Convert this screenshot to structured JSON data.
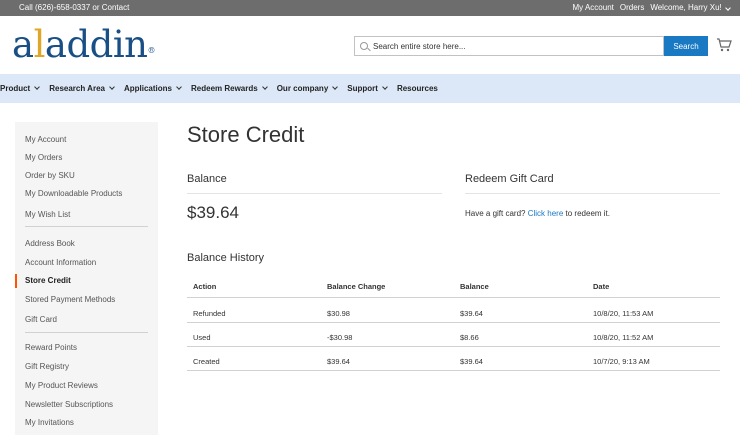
{
  "topbar": {
    "call_text": "Call (626)-658-0337 or",
    "contact": "Contact",
    "my_account": "My Account",
    "orders": "Orders",
    "welcome": "Welcome, Harry Xu!"
  },
  "header": {
    "logo_part1": "a",
    "logo_gold": "l",
    "logo_part2": "addin",
    "logo_reg": "®",
    "search_placeholder": "Search entire store here...",
    "search_button": "Search"
  },
  "nav": {
    "items": [
      {
        "label": "Product",
        "dropdown": true
      },
      {
        "label": "Research Area",
        "dropdown": true
      },
      {
        "label": "Applications",
        "dropdown": true
      },
      {
        "label": "Redeem Rewards",
        "dropdown": true
      },
      {
        "label": "Our company",
        "dropdown": true
      },
      {
        "label": "Support",
        "dropdown": true
      },
      {
        "label": "Resources",
        "dropdown": false
      }
    ]
  },
  "sidebar": {
    "group1": [
      "My Account",
      "My Orders",
      "Order by SKU",
      "My Downloadable Products",
      "My Wish List"
    ],
    "group2": [
      "Address Book",
      "Account Information",
      "Store Credit",
      "Stored Payment Methods",
      "Gift Card"
    ],
    "group3": [
      "Reward Points",
      "Gift Registry",
      "My Product Reviews",
      "Newsletter Subscriptions",
      "My Invitations"
    ],
    "active": "Store Credit"
  },
  "main": {
    "title": "Store Credit",
    "balance_title": "Balance",
    "balance_amount": "$39.64",
    "redeem_title": "Redeem Gift Card",
    "redeem_prefix": "Have a gift card?",
    "redeem_link": "Click here",
    "redeem_suffix": "to redeem it.",
    "history_title": "Balance History",
    "history": {
      "columns": [
        "Action",
        "Balance Change",
        "Balance",
        "Date"
      ],
      "rows": [
        [
          "Refunded",
          "$30.98",
          "$39.64",
          "10/8/20, 11:53 AM"
        ],
        [
          "Used",
          "-$30.98",
          "$8.66",
          "10/8/20, 11:52 AM"
        ],
        [
          "Created",
          "$39.64",
          "$39.64",
          "10/7/20, 9:13 AM"
        ]
      ]
    }
  },
  "colors": {
    "topbar_bg": "#6d6d6d",
    "nav_bg": "#dce8f7",
    "brand_blue": "#1a4f86",
    "brand_gold": "#e2a626",
    "button_blue": "#1979c3",
    "active_accent": "#ff5501"
  }
}
